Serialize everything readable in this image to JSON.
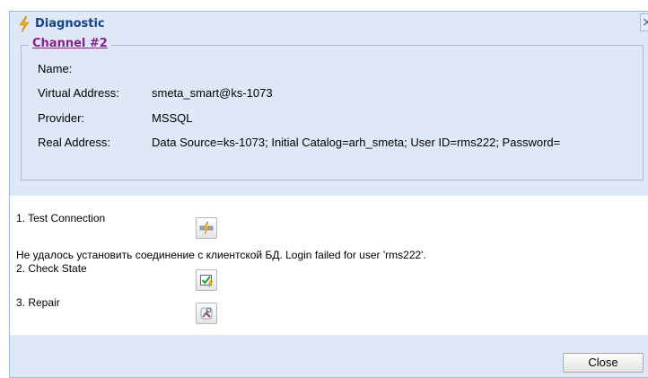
{
  "window": {
    "title": "Diagnostic",
    "close_glyph": "×"
  },
  "channel": {
    "legend": "Channel #2",
    "fields": [
      {
        "label": "Name:",
        "value": ""
      },
      {
        "label": "Virtual Address:",
        "value": "smeta_smart@ks-1073"
      },
      {
        "label": "Provider:",
        "value": "MSSQL"
      },
      {
        "label": "Real Address:",
        "value": "Data Source=ks-1073; Initial Catalog=arh_smeta; User ID=rms222; Password="
      }
    ]
  },
  "steps": [
    {
      "label": "1. Test Connection",
      "icon": "test-connection-icon"
    },
    {
      "label": "2. Check State",
      "icon": "check-state-icon"
    },
    {
      "label": "3. Repair",
      "icon": "repair-icon"
    }
  ],
  "error_message": "Не удалось установить соединение с клиентской БД. Login failed for user 'rms222'.",
  "footer": {
    "close_label": "Close"
  },
  "colors": {
    "title": "#15428b",
    "window_bg": "#dfe8f6",
    "legend": "#8a1e8a",
    "border": "#99bbe8"
  }
}
